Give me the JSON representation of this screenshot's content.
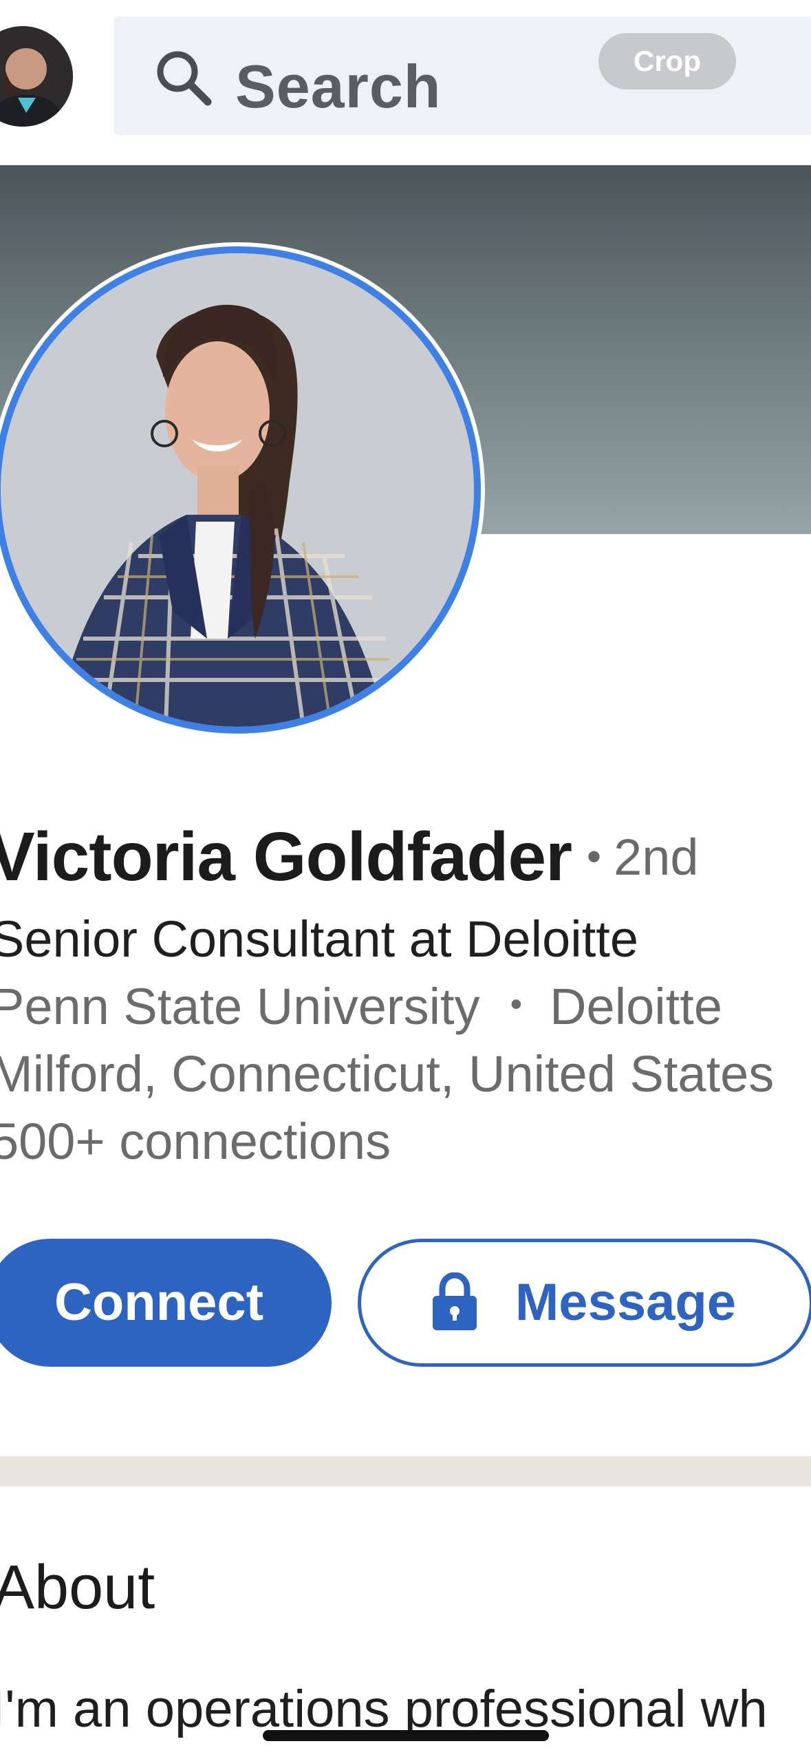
{
  "header": {
    "search_placeholder": "Search",
    "crop_label": "Crop"
  },
  "profile": {
    "name": "Victoria Goldfader",
    "degree_separator": "•",
    "degree": "2nd",
    "headline": "Senior Consultant at Deloitte",
    "education": "Penn State University",
    "company": "Deloitte",
    "meta_separator": "•",
    "location": "Milford, Connecticut, United States",
    "connections": "500+ connections"
  },
  "actions": {
    "connect_label": "Connect",
    "message_label": "Message"
  },
  "about": {
    "title": "About",
    "text": "I'm an operations professional wh"
  },
  "colors": {
    "accent": "#2e64c1",
    "photo_ring": "#3f80e6",
    "divider": "#e8e5df"
  },
  "icons": {
    "search": "search-icon",
    "lock": "lock-icon"
  }
}
